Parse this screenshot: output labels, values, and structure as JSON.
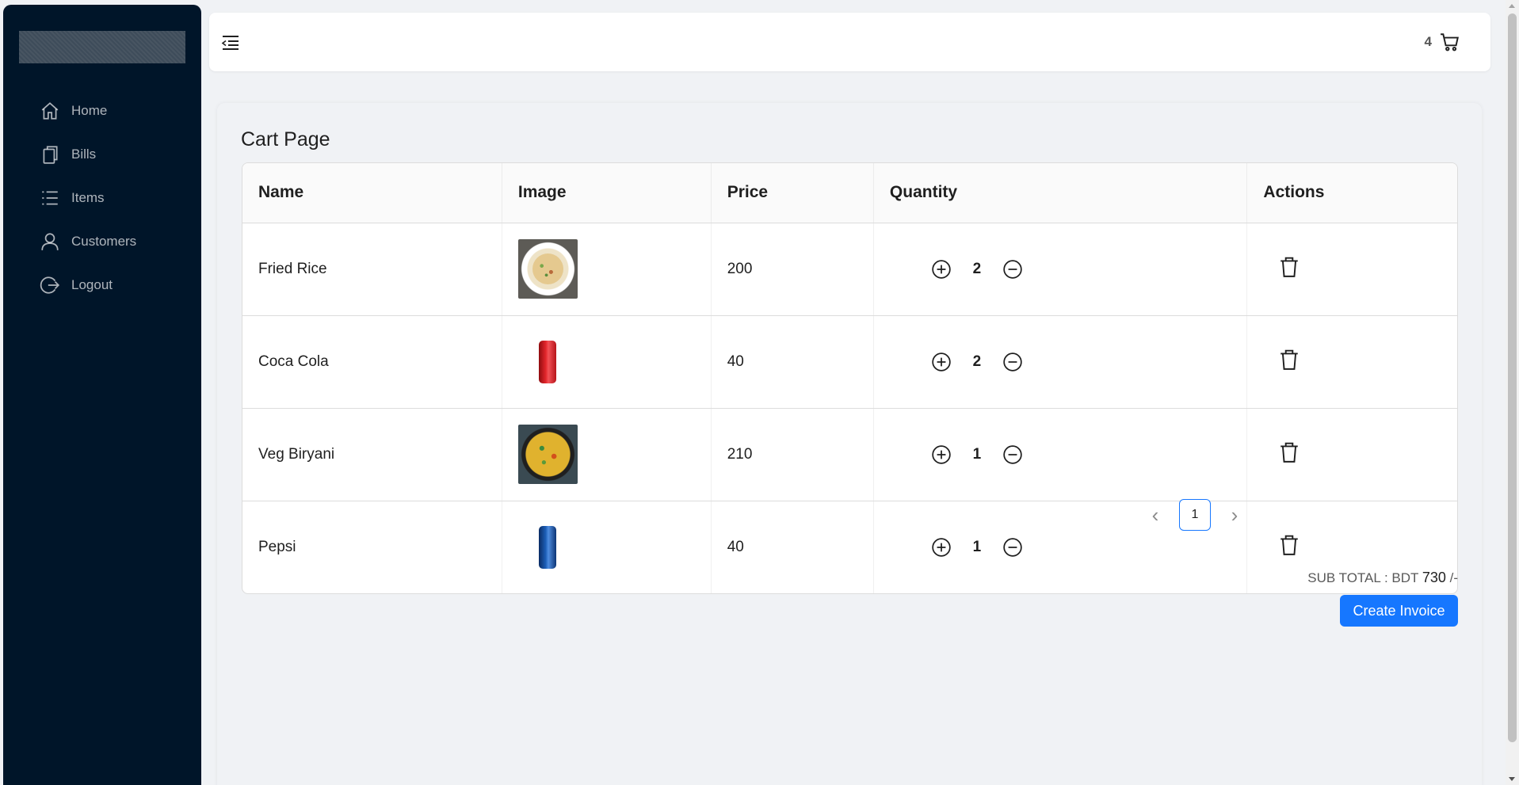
{
  "sidebar": {
    "items": [
      {
        "label": "Home",
        "icon": "home-icon"
      },
      {
        "label": "Bills",
        "icon": "copy-icon"
      },
      {
        "label": "Items",
        "icon": "list-icon"
      },
      {
        "label": "Customers",
        "icon": "user-icon"
      },
      {
        "label": "Logout",
        "icon": "logout-icon"
      }
    ]
  },
  "header": {
    "menu_icon": "menu-fold-icon",
    "cart_count": "4",
    "cart_icon": "shopping-cart-icon"
  },
  "main": {
    "title": "Cart Page",
    "columns": [
      "Name",
      "Image",
      "Price",
      "Quantity",
      "Actions"
    ],
    "rows": [
      {
        "name": "Fried Rice",
        "image": "fried-rice-image",
        "price": "200",
        "quantity": "2"
      },
      {
        "name": "Coca Cola",
        "image": "coca-cola-can-image",
        "price": "40",
        "quantity": "2"
      },
      {
        "name": "Veg Biryani",
        "image": "veg-biryani-image",
        "price": "210",
        "quantity": "1"
      },
      {
        "name": "Pepsi",
        "image": "pepsi-can-image",
        "price": "40",
        "quantity": "1"
      }
    ],
    "pagination": {
      "current": "1"
    },
    "subtotal_label": "SUB TOTAL : BDT",
    "subtotal_value": "730",
    "subtotal_suffix": "/-",
    "create_invoice_label": "Create Invoice"
  },
  "colors": {
    "sidebar_bg": "#001529",
    "primary": "#1677ff",
    "page_bg": "#f0f2f5"
  }
}
